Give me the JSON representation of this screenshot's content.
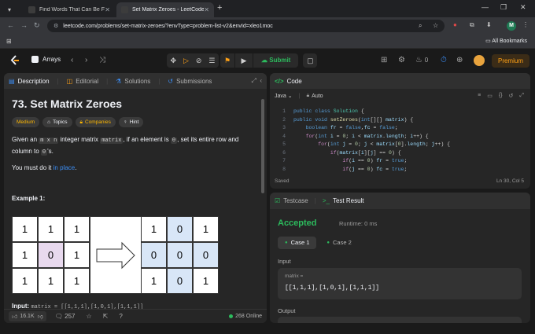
{
  "browser": {
    "tabs": [
      {
        "title": "Find Words That Can Be Forme",
        "active": false
      },
      {
        "title": "Set Matrix Zeroes - LeetCode",
        "active": true
      }
    ],
    "new_tab_icon": "+",
    "url": "leetcode.com/problems/set-matrix-zeroes/?envType=problem-list-v2&envId=xleo1moc",
    "profile_initial": "M",
    "bookmarks_label": "All Bookmarks"
  },
  "header": {
    "problem_list": "Arrays",
    "submit_label": "Submit",
    "streak_count": "0",
    "premium_label": "Premium"
  },
  "description_panel": {
    "tabs": [
      "Description",
      "Editorial",
      "Solutions",
      "Submissions"
    ],
    "title": "73. Set Matrix Zeroes",
    "badges": [
      "Medium",
      "Topics",
      "Companies",
      "Hint"
    ],
    "text_pre": "Given an",
    "code_mxn": "m x n",
    "text_mid1": "integer matrix",
    "code_matrix": "matrix",
    "text_mid2": ", if an element is",
    "code_zero": "0",
    "text_mid3": ", set its entire row and column to",
    "code_zero2": "0",
    "text_post": "'s.",
    "must_do": "You must do it",
    "in_place": "in place",
    "must_do_end": ".",
    "example_title": "Example 1:",
    "matrix_before": [
      [
        "1",
        "1",
        "1"
      ],
      [
        "1",
        "0",
        "1"
      ],
      [
        "1",
        "1",
        "1"
      ]
    ],
    "matrix_after": [
      [
        "1",
        "0",
        "1"
      ],
      [
        "0",
        "0",
        "0"
      ],
      [
        "1",
        "0",
        "1"
      ]
    ],
    "input_label": "Input:",
    "input_value": "matrix = [[1,1,1],[1,0,1],[1,1,1]]",
    "likes": "16.1K",
    "comments": "257",
    "online": "268 Online",
    "colors": {
      "highlight_zero": "#e8d9ee",
      "affected": "#d8e6f7",
      "medium": "#ffb800"
    }
  },
  "code_panel": {
    "title": "Code",
    "language": "Java",
    "mode": "Auto",
    "lines": [
      {
        "n": "1",
        "html": "<span class='kw'>public</span> <span class='kw'>class</span> <span class='ty'>Solution</span> {"
      },
      {
        "n": "2",
        "html": "<span class='kw'>public</span> <span class='kw'>void</span> <span class='fn'>setZeroes</span>(<span class='kw'>int</span>[][] <span class='vr'>matrix</span>) {"
      },
      {
        "n": "3",
        "html": "    <span class='kw'>boolean</span> <span class='vr'>fr</span> = <span class='kw'>false</span>,<span class='vr'>fc</span> = <span class='kw'>false</span>;"
      },
      {
        "n": "4",
        "html": "    <span class='ctl'>for</span>(<span class='kw'>int</span> <span class='vr'>i</span> = <span class='nm'>0</span>; <span class='vr'>i</span> &lt; <span class='vr'>matrix</span>.<span class='vr'>length</span>; <span class='vr'>i</span>++) {"
      },
      {
        "n": "5",
        "html": "        <span class='ctl'>for</span>(<span class='kw'>int</span> <span class='vr'>j</span> = <span class='nm'>0</span>; <span class='vr'>j</span> &lt; <span class='vr'>matrix</span>[<span class='nm'>0</span>].<span class='vr'>length</span>; <span class='vr'>j</span>++) {"
      },
      {
        "n": "6",
        "html": "            <span class='ctl'>if</span>(<span class='vr'>matrix</span>[<span class='vr'>i</span>][<span class='vr'>j</span>] == <span class='nm'>0</span>) {"
      },
      {
        "n": "7",
        "html": "                <span class='ctl'>if</span>(<span class='vr'>i</span> == <span class='nm'>0</span>) <span class='vr'>fr</span> = <span class='kw'>true</span>;"
      },
      {
        "n": "8",
        "html": "                <span class='ctl'>if</span>(<span class='vr'>j</span> == <span class='nm'>0</span>) <span class='vr'>fc</span> = <span class='kw'>true</span>;"
      }
    ],
    "status": "Saved",
    "cursor": "Ln 30, Col 5"
  },
  "result_panel": {
    "tabs": [
      "Testcase",
      "Test Result"
    ],
    "status": "Accepted",
    "runtime": "Runtime: 0 ms",
    "cases": [
      "Case 1",
      "Case 2"
    ],
    "input_label": "Input",
    "param_name": "matrix =",
    "param_value": "[[1,1,1],[1,0,1],[1,1,1]]",
    "output_label": "Output"
  }
}
